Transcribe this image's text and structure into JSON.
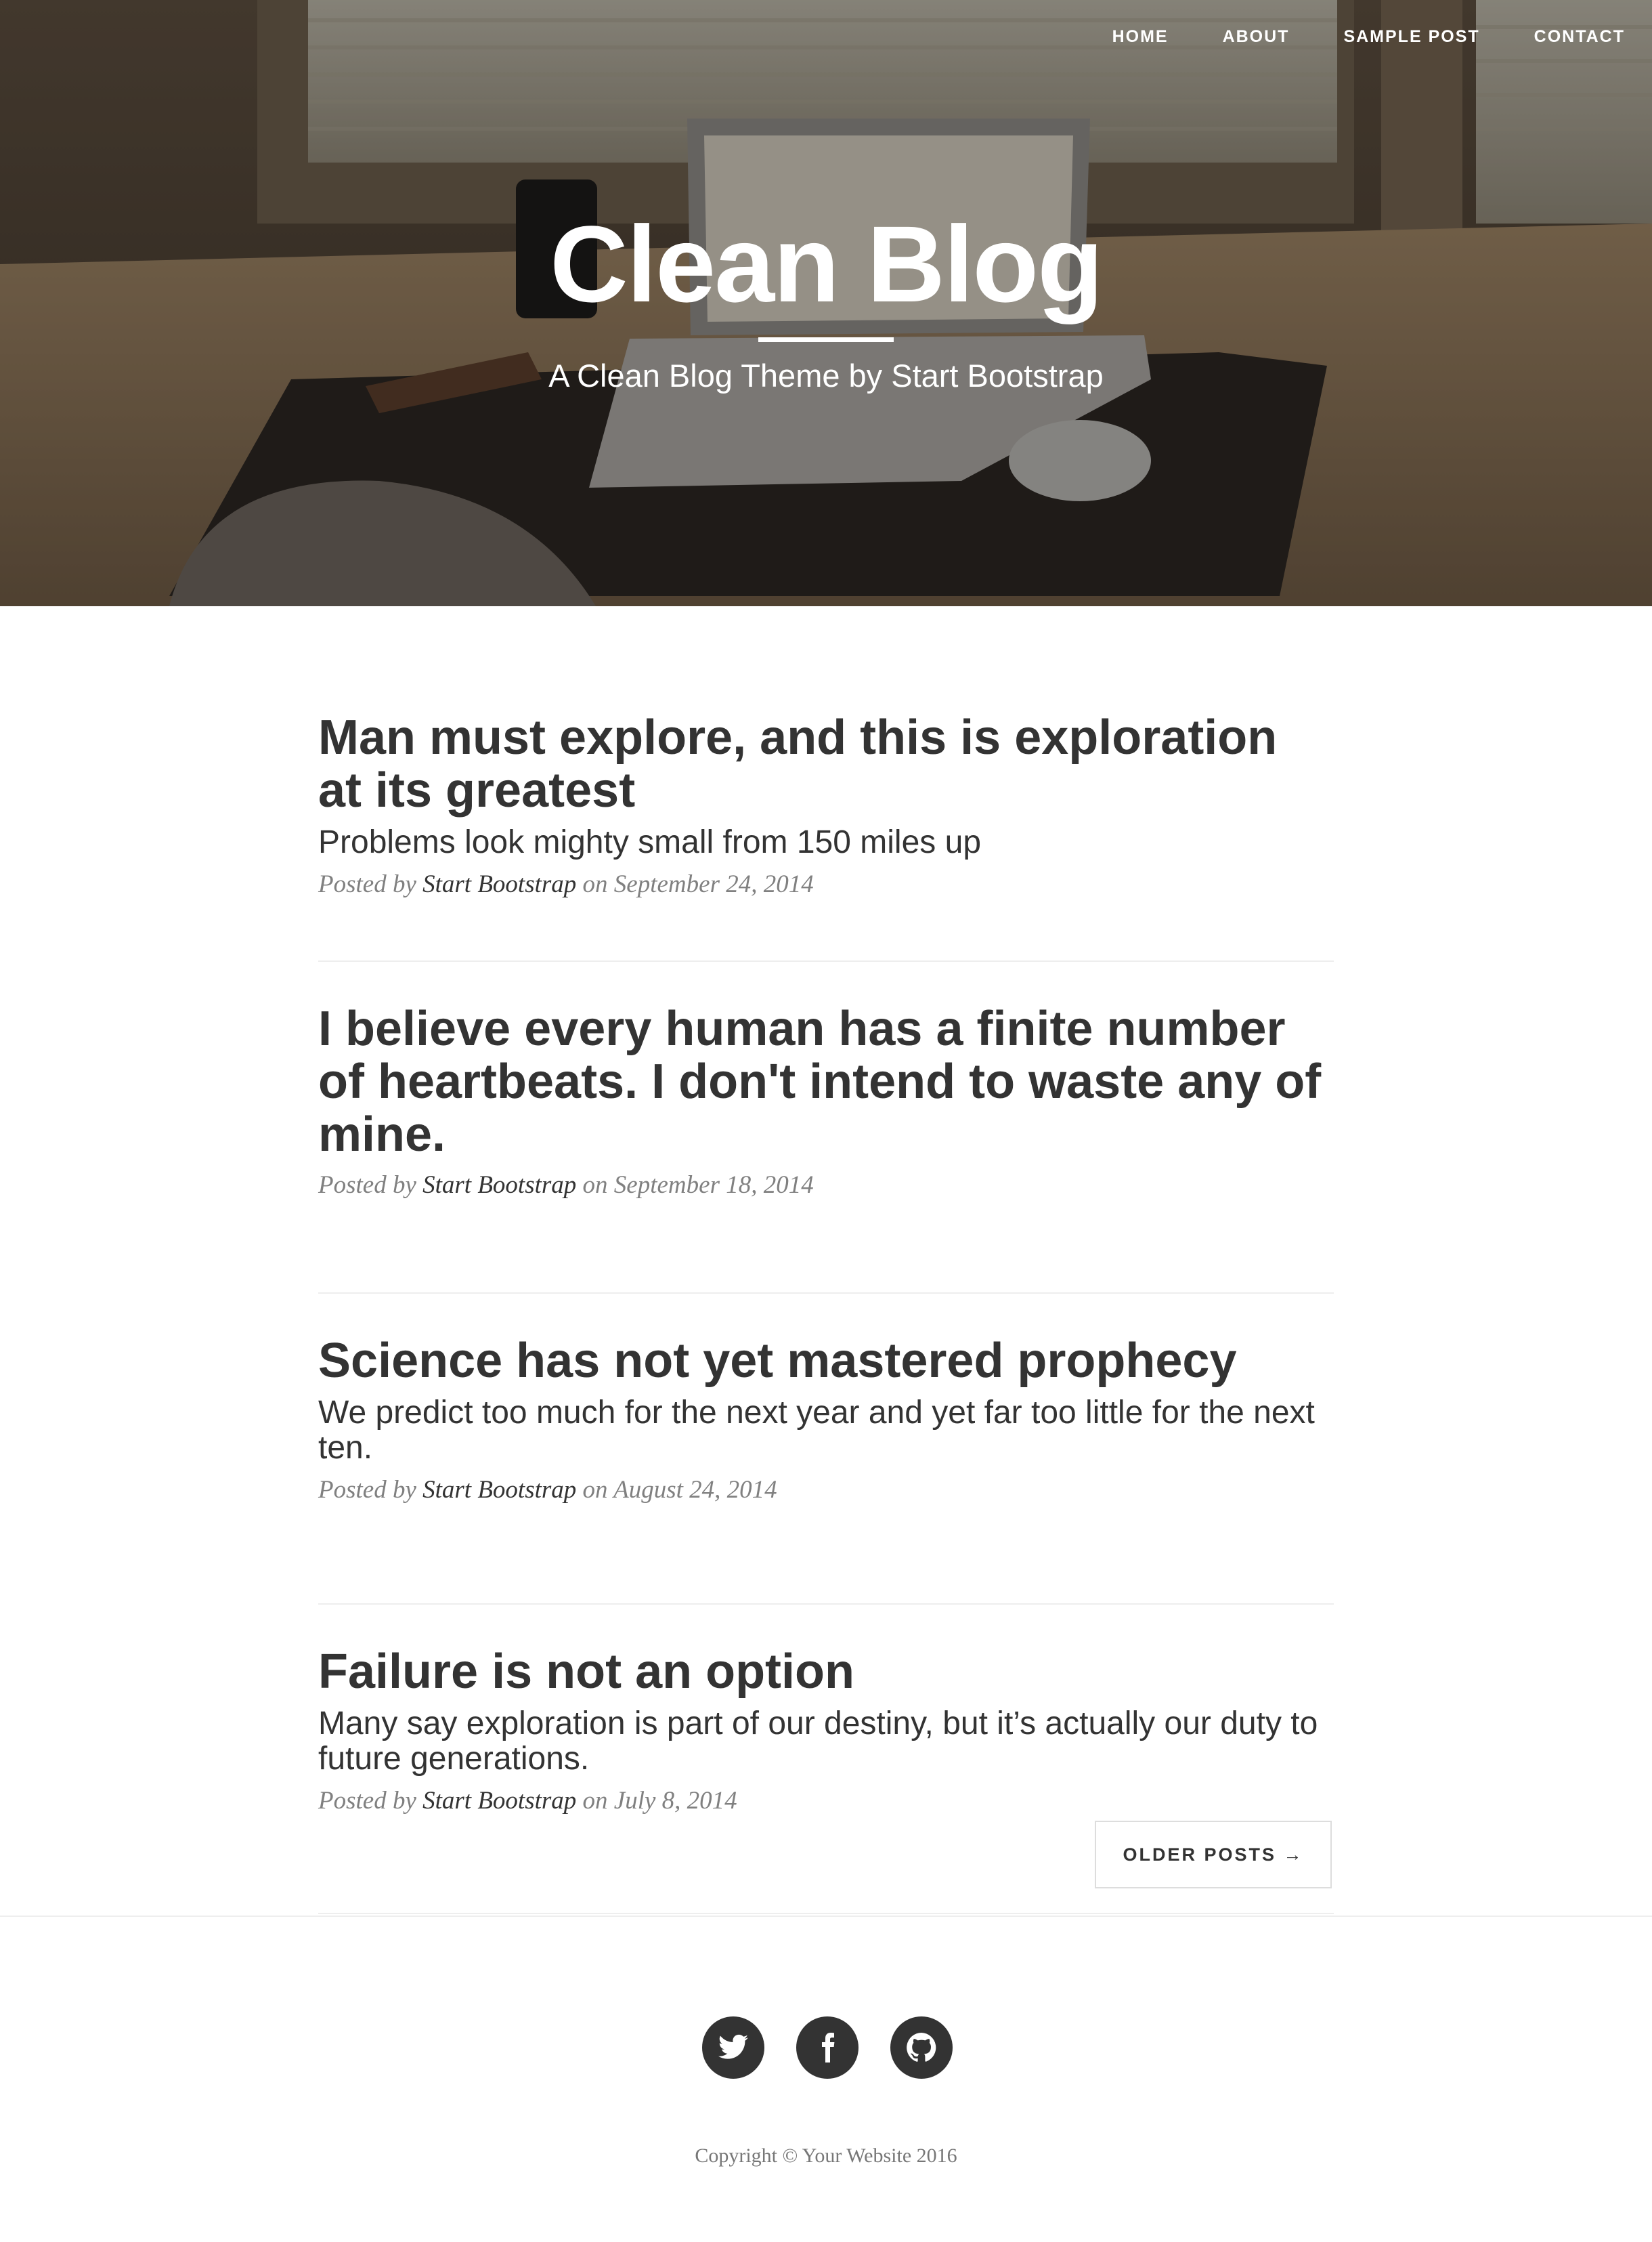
{
  "nav": {
    "items": [
      "Home",
      "About",
      "Sample Post",
      "Contact"
    ]
  },
  "header": {
    "title": "Clean Blog",
    "subtitle": "A Clean Blog Theme by Start Bootstrap"
  },
  "posts": [
    {
      "title": "Man must explore, and this is exploration at its greatest",
      "subtitle": "Problems look mighty small from 150 miles up",
      "posted_by": "Posted by",
      "author": "Start Bootstrap",
      "on": "on",
      "date": "September 24, 2014"
    },
    {
      "title": "I believe every human has a finite number of heartbeats. I don't intend to waste any of mine.",
      "subtitle": "",
      "posted_by": "Posted by",
      "author": "Start Bootstrap",
      "on": "on",
      "date": "September 18, 2014"
    },
    {
      "title": "Science has not yet mastered prophecy",
      "subtitle": "We predict too much for the next year and yet far too little for the next ten.",
      "posted_by": "Posted by",
      "author": "Start Bootstrap",
      "on": "on",
      "date": "August 24, 2014"
    },
    {
      "title": "Failure is not an option",
      "subtitle": "Many say exploration is part of our destiny, but it’s actually our duty to future generations.",
      "posted_by": "Posted by",
      "author": "Start Bootstrap",
      "on": "on",
      "date": "July 8, 2014"
    }
  ],
  "pager": {
    "label": "Older Posts →"
  },
  "footer": {
    "social": [
      "twitter-icon",
      "facebook-icon",
      "github-icon"
    ],
    "copyright": "Copyright © Your Website 2016"
  },
  "colors": {
    "text": "#333333",
    "meta": "#808080",
    "rule": "#eeeeee"
  }
}
